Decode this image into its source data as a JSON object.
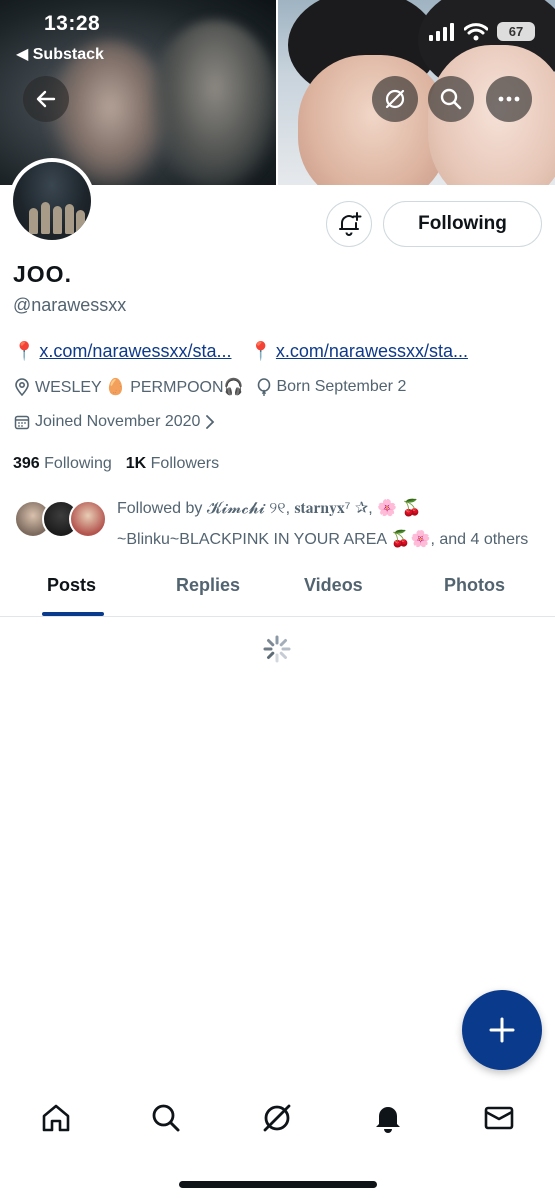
{
  "status_bar": {
    "time": "13:28",
    "back_app": "◀ Substack",
    "battery": "67"
  },
  "profile": {
    "display_name": "JOO.",
    "handle": "@narawessxx",
    "links": [
      {
        "text": "x.com/narawessxx/sta..."
      },
      {
        "text": "x.com/narawessxx/sta..."
      }
    ],
    "location": "WESLEY 🥚 PERMPOON🎧",
    "birthday": "Born September 2",
    "joined": "Joined November 2020",
    "following_count": "396",
    "following_label": "Following",
    "followers_count": "1K",
    "followers_label": "Followers",
    "followed_by": "Followed by 𝓚𝓲𝓶𝓬𝓱𝓲 ୨୧, 𝐬𝐭𝐚𝐫𝐧𝐲𝐱⁷ ✰, 🌸 🍒 ~Blinku~BLACKPINK IN YOUR AREA 🍒🌸, and 4 others"
  },
  "actions": {
    "following_button": "Following"
  },
  "tabs": [
    {
      "label": "Posts",
      "active": true
    },
    {
      "label": "Replies",
      "active": false
    },
    {
      "label": "Videos",
      "active": false
    },
    {
      "label": "Photos",
      "active": false
    }
  ],
  "colors": {
    "accent": "#0a3a8c",
    "link": "#0f3a8a",
    "secondary_text": "#536471"
  },
  "icons": {
    "back": "arrow-left-icon",
    "feed": "feeds-icon",
    "search": "search-icon",
    "more": "more-icon",
    "bell": "bell-plus-icon",
    "fab": "plus-icon",
    "nav": [
      "home-icon",
      "search-icon",
      "feeds-icon",
      "bell-icon",
      "mail-icon"
    ]
  }
}
